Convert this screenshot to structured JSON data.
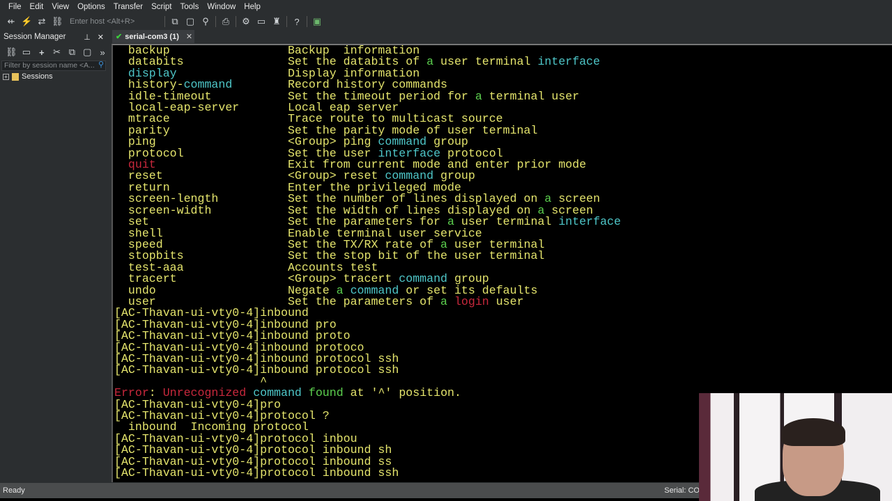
{
  "menu": [
    "File",
    "Edit",
    "View",
    "Options",
    "Transfer",
    "Script",
    "Tools",
    "Window",
    "Help"
  ],
  "toolbar": {
    "host_placeholder": "Enter host <Alt+R>"
  },
  "session_manager": {
    "title": "Session Manager",
    "filter_placeholder": "Filter by session name <A...",
    "tree_root": "Sessions"
  },
  "tab": {
    "label": "serial-com3 (1)"
  },
  "colors": {
    "y": "#e4e46c",
    "c": "#4ec6c8",
    "g": "#5ccf4e",
    "r": "#c8283c"
  },
  "terminal_lines": [
    [
      [
        "  backup                 Backup  information",
        "y"
      ]
    ],
    [
      [
        "  databits               Set the databits of ",
        "y"
      ],
      [
        "a",
        "g"
      ],
      [
        " user terminal ",
        "y"
      ],
      [
        "interface",
        "c"
      ]
    ],
    [
      [
        "  ",
        "y"
      ],
      [
        "display",
        "c"
      ],
      [
        "                Display information",
        "y"
      ]
    ],
    [
      [
        "  history-",
        "y"
      ],
      [
        "command",
        "c"
      ],
      [
        "        Record history commands",
        "y"
      ]
    ],
    [
      [
        "  idle-timeout           Set the timeout period for ",
        "y"
      ],
      [
        "a",
        "g"
      ],
      [
        " terminal user",
        "y"
      ]
    ],
    [
      [
        "  local-eap-server       Local eap server",
        "y"
      ]
    ],
    [
      [
        "  mtrace                 Trace route to multicast source",
        "y"
      ]
    ],
    [
      [
        "  parity                 Set the parity mode of user terminal",
        "y"
      ]
    ],
    [
      [
        "  ping                   <Group> ping ",
        "y"
      ],
      [
        "command",
        "c"
      ],
      [
        " group",
        "y"
      ]
    ],
    [
      [
        "  protocol               Set the user ",
        "y"
      ],
      [
        "interface",
        "c"
      ],
      [
        " protocol",
        "y"
      ]
    ],
    [
      [
        "  ",
        "y"
      ],
      [
        "quit",
        "r"
      ],
      [
        "                   Exit from current mode and enter prior mode",
        "y"
      ]
    ],
    [
      [
        "  reset                  <Group> reset ",
        "y"
      ],
      [
        "command",
        "c"
      ],
      [
        " group",
        "y"
      ]
    ],
    [
      [
        "  return                 Enter the privileged mode",
        "y"
      ]
    ],
    [
      [
        "  screen-length          Set the number of lines displayed on ",
        "y"
      ],
      [
        "a",
        "g"
      ],
      [
        " screen",
        "y"
      ]
    ],
    [
      [
        "  screen-width           Set the width of lines displayed on ",
        "y"
      ],
      [
        "a",
        "g"
      ],
      [
        " screen",
        "y"
      ]
    ],
    [
      [
        "  set                    Set the parameters for ",
        "y"
      ],
      [
        "a",
        "g"
      ],
      [
        " user terminal ",
        "y"
      ],
      [
        "interface",
        "c"
      ]
    ],
    [
      [
        "  shell                  Enable terminal user service",
        "y"
      ]
    ],
    [
      [
        "  speed                  Set the TX/RX rate of ",
        "y"
      ],
      [
        "a",
        "g"
      ],
      [
        " user terminal",
        "y"
      ]
    ],
    [
      [
        "  stopbits               Set the stop bit of the user terminal",
        "y"
      ]
    ],
    [
      [
        "  test-aaa               Accounts test",
        "y"
      ]
    ],
    [
      [
        "  tracert                <Group> tracert ",
        "y"
      ],
      [
        "command",
        "c"
      ],
      [
        " group",
        "y"
      ]
    ],
    [
      [
        "  undo                   Negate ",
        "y"
      ],
      [
        "a",
        "g"
      ],
      [
        " ",
        "y"
      ],
      [
        "command",
        "c"
      ],
      [
        " or set its defaults",
        "y"
      ]
    ],
    [
      [
        "  user                   Set the parameters of ",
        "y"
      ],
      [
        "a",
        "g"
      ],
      [
        " ",
        "y"
      ],
      [
        "login",
        "r"
      ],
      [
        " user",
        "y"
      ]
    ],
    [
      [
        "[AC-Thavan-ui-vty0-4]inbound",
        "y"
      ]
    ],
    [
      [
        "[AC-Thavan-ui-vty0-4]inbound pro",
        "y"
      ]
    ],
    [
      [
        "[AC-Thavan-ui-vty0-4]inbound proto",
        "y"
      ]
    ],
    [
      [
        "[AC-Thavan-ui-vty0-4]inbound protoco",
        "y"
      ]
    ],
    [
      [
        "[AC-Thavan-ui-vty0-4]inbound protocol ssh",
        "y"
      ]
    ],
    [
      [
        "[AC-Thavan-ui-vty0-4]inbound protocol ssh",
        "y"
      ]
    ],
    [
      [
        "                     ^",
        "y"
      ]
    ],
    [
      [
        "Error",
        "r"
      ],
      [
        ": ",
        "y"
      ],
      [
        "Unrecognized",
        "r"
      ],
      [
        " ",
        "y"
      ],
      [
        "command",
        "c"
      ],
      [
        " ",
        "y"
      ],
      [
        "found",
        "g"
      ],
      [
        " at '^' position.",
        "y"
      ]
    ],
    [
      [
        "[AC-Thavan-ui-vty0-4]pro",
        "y"
      ]
    ],
    [
      [
        "[AC-Thavan-ui-vty0-4]protocol ?",
        "y"
      ]
    ],
    [
      [
        "  inbound  Incoming protocol",
        "y"
      ]
    ],
    [
      [
        "[AC-Thavan-ui-vty0-4]protocol inbou",
        "y"
      ]
    ],
    [
      [
        "[AC-Thavan-ui-vty0-4]protocol inbound sh",
        "y"
      ]
    ],
    [
      [
        "[AC-Thavan-ui-vty0-4]protocol inbound ss",
        "y"
      ]
    ],
    [
      [
        "[AC-Thavan-ui-vty0-4]protocol inbound ssh",
        "y"
      ]
    ]
  ],
  "status": {
    "left": "Ready",
    "right": "Serial: CO"
  }
}
